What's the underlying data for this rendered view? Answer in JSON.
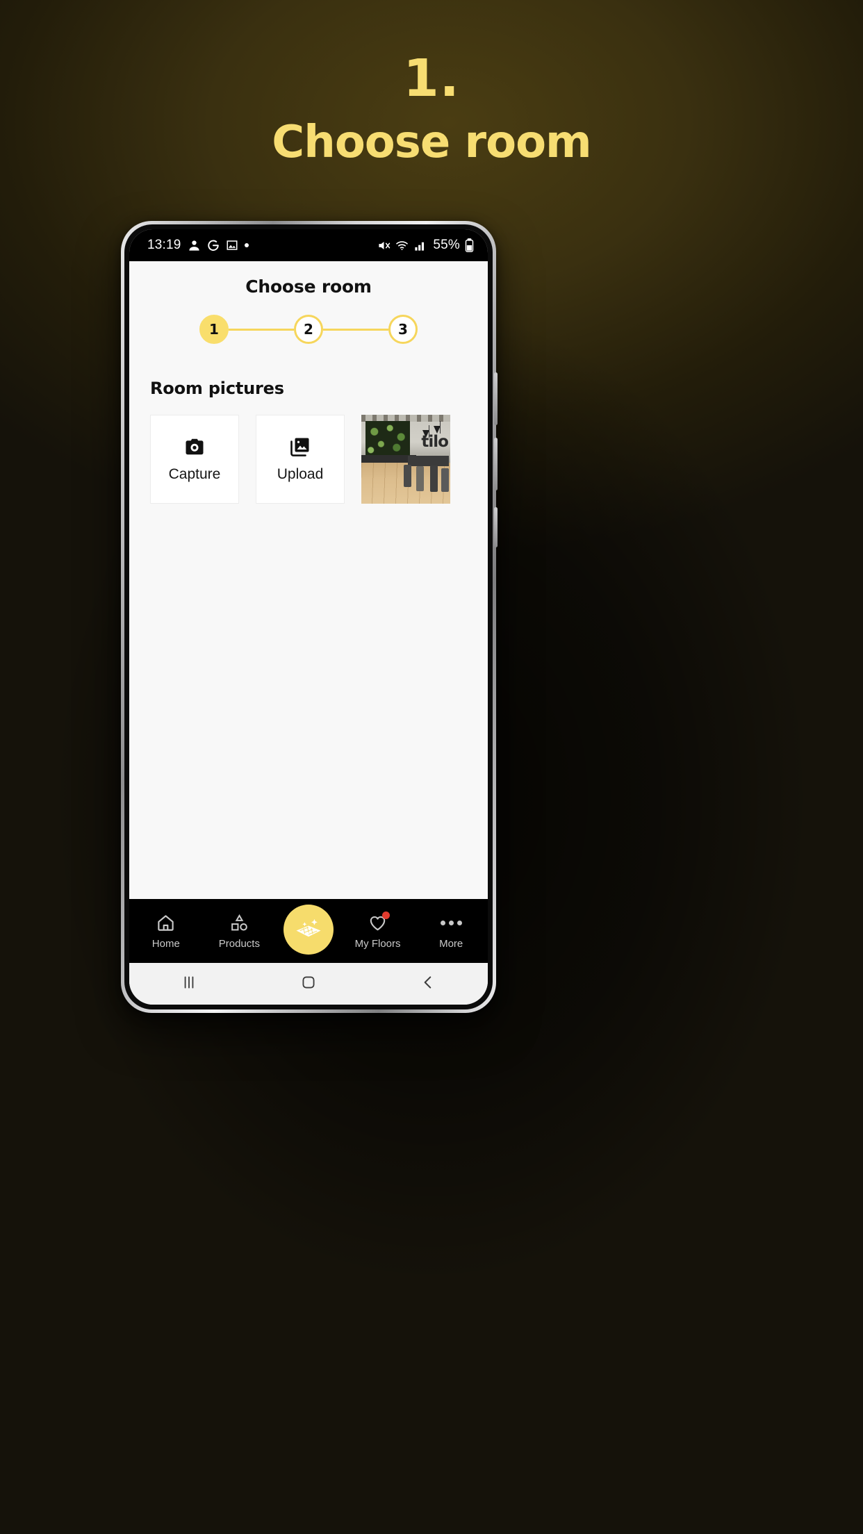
{
  "poster": {
    "step_number": "1.",
    "headline": "Choose room",
    "accent_color": "#F7DD72"
  },
  "statusbar": {
    "time": "13:19",
    "left_icons": [
      "contacts-icon",
      "google-icon",
      "gallery-icon",
      "dot-icon"
    ],
    "right_icons": [
      "mute-icon",
      "wifi-icon",
      "signal-icon"
    ],
    "battery": "55%"
  },
  "app": {
    "title": "Choose room",
    "stepper": {
      "steps": [
        {
          "label": "1",
          "active": true
        },
        {
          "label": "2",
          "active": false
        },
        {
          "label": "3",
          "active": false
        }
      ]
    },
    "section": {
      "title": "Room pictures",
      "cards": [
        {
          "label": "Capture",
          "icon": "camera-icon"
        },
        {
          "label": "Upload",
          "icon": "photo-library-icon"
        }
      ],
      "thumbnail": {
        "alt": "room-photo",
        "brand_text": "tilo"
      }
    }
  },
  "bottom_nav": {
    "items": [
      {
        "label": "Home",
        "icon": "home-icon"
      },
      {
        "label": "Products",
        "icon": "shapes-icon"
      },
      {
        "label": "",
        "icon": "floor-sparkle-icon"
      },
      {
        "label": "My Floors",
        "icon": "heart-icon",
        "badge": true
      },
      {
        "label": "More",
        "icon": "more-dots-icon"
      }
    ],
    "accent_color": "#F6DC6C"
  },
  "system_nav": {
    "recents": "|||",
    "home": "home-square-icon",
    "back": "back-chevron-icon"
  }
}
